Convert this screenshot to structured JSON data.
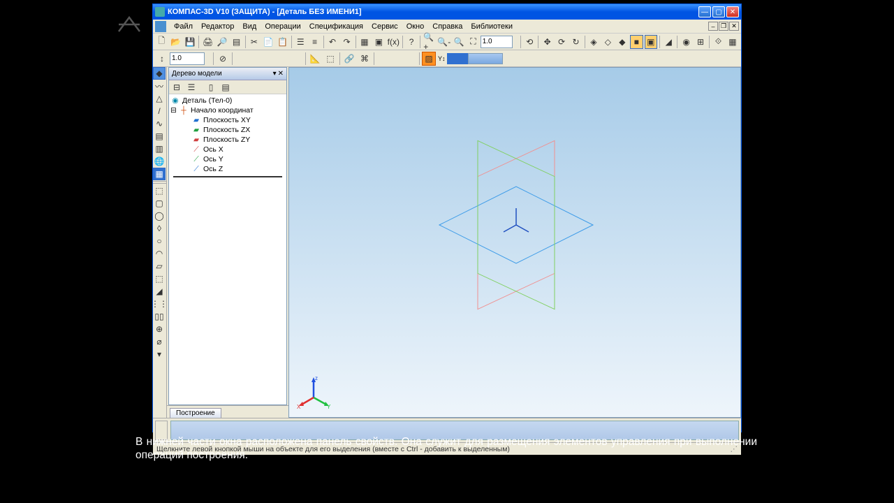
{
  "titlebar": {
    "text": "КОМПАС-3D V10 (ЗАЩИТА) - [Деталь БЕЗ ИМЕНИ1]"
  },
  "menu": {
    "items": [
      "Файл",
      "Редактор",
      "Вид",
      "Операции",
      "Спецификация",
      "Сервис",
      "Окно",
      "Справка",
      "Библиотеки"
    ]
  },
  "toolbar_combo1": "1.0",
  "toolbar_combo2": "1.0",
  "tree": {
    "title": "Дерево модели",
    "root": "Деталь (Тел-0)",
    "origin": "Начало координат",
    "planes": [
      "Плоскость XY",
      "Плоскость ZX",
      "Плоскость ZY"
    ],
    "axes": [
      "Ось X",
      "Ось Y",
      "Ось Z"
    ]
  },
  "tab": "Построение",
  "statusbar": "Щелкните левой кнопкой мыши на объекте для его выделения (вместе c Ctrl - добавить к выделенным)",
  "caption": "В нижней части окна расположена панель свойств. Она служит для размещения элементов управления при выполнении операций построения."
}
